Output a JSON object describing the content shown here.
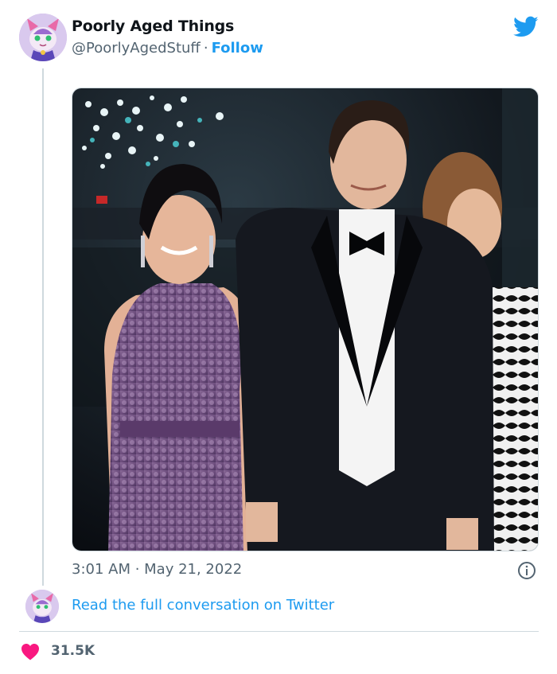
{
  "author": {
    "display_name": "Poorly Aged Things",
    "handle": "@PoorlyAgedStuff",
    "separator": "·",
    "follow_label": "Follow"
  },
  "icons": {
    "brand": "twitter-bird-icon",
    "info": "info-icon",
    "like": "heart-icon"
  },
  "tweet": {
    "timestamp": "3:01 AM · May 21, 2022"
  },
  "footer": {
    "read_more_label": "Read the full conversation on Twitter",
    "like_count": "31.5K"
  },
  "colors": {
    "accent": "#1d9bf0",
    "heart": "#f91880",
    "muted_text": "#536471",
    "border": "#cfd9de"
  }
}
